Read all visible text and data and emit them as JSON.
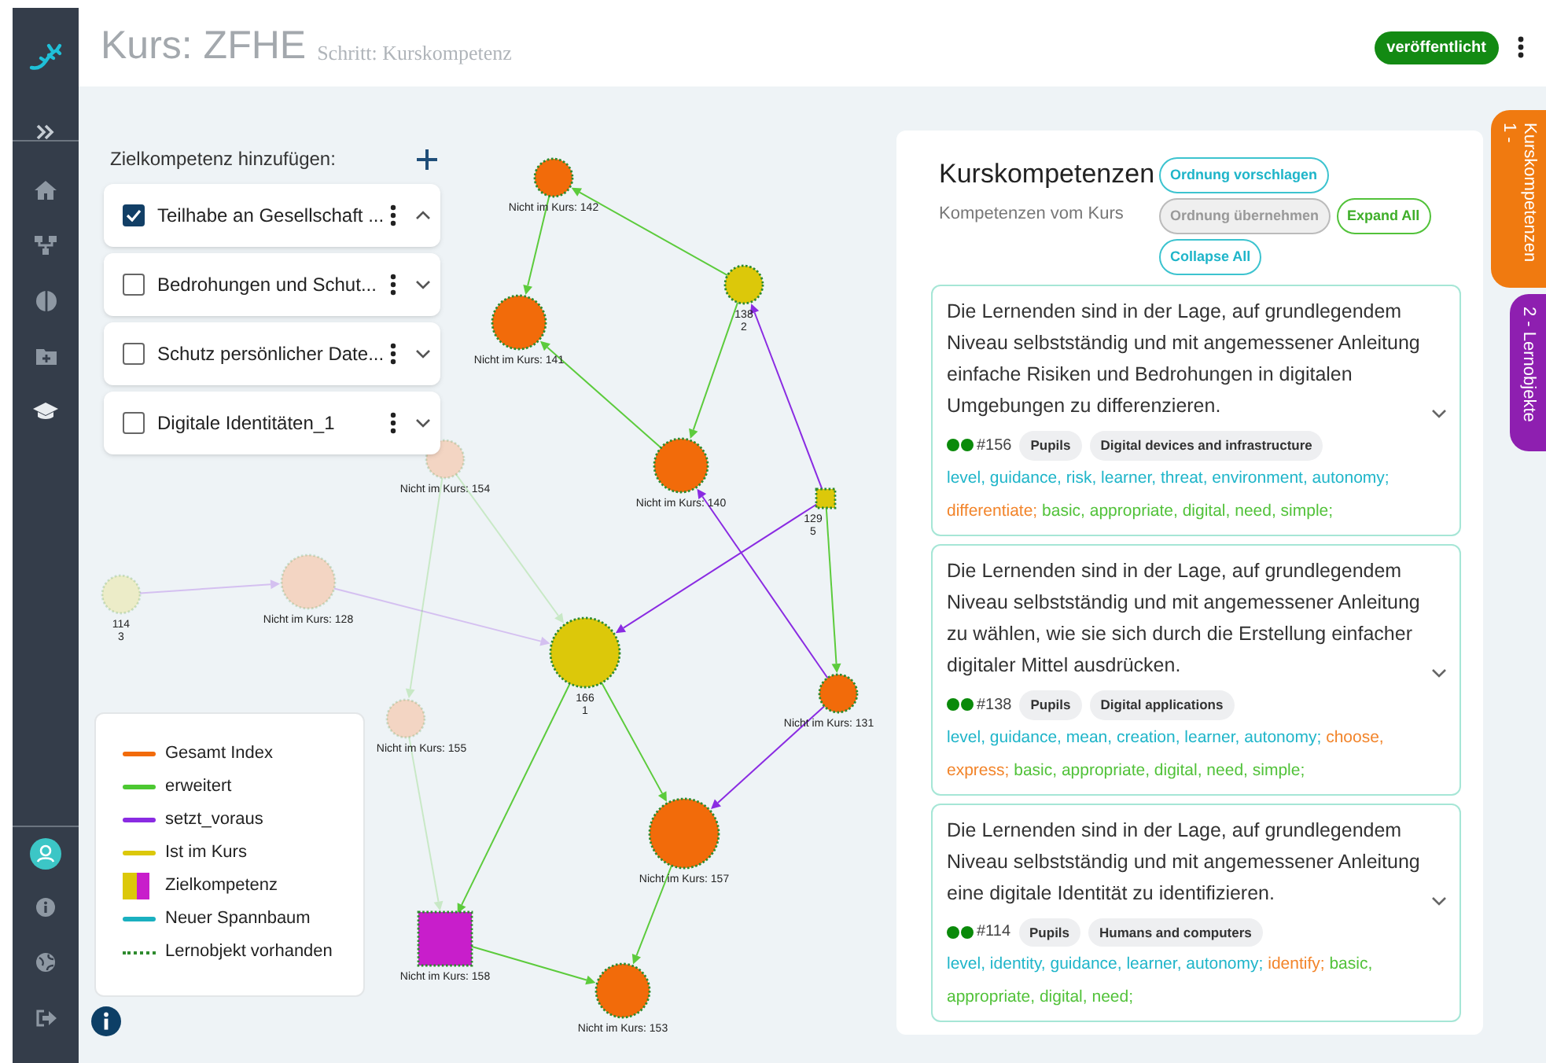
{
  "header": {
    "course_title": "Kurs: ZFHE",
    "step": "Schritt: Kurskompetenz",
    "status_badge": "veröffentlicht"
  },
  "goal_panel": {
    "title": "Zielkompetenz hinzufügen:",
    "items": [
      {
        "label": "Teilhabe an Gesellschaft ...",
        "checked": true,
        "expanded": true
      },
      {
        "label": "Bedrohungen und Schut...",
        "checked": false,
        "expanded": false
      },
      {
        "label": "Schutz persönlicher Date...",
        "checked": false,
        "expanded": false
      },
      {
        "label": "Digitale Identitäten_1",
        "checked": false,
        "expanded": false
      }
    ]
  },
  "graph": {
    "nodes": [
      {
        "label_lines": [
          "Nicht im Kurs: 142"
        ],
        "kind": "circle",
        "color": "#f26b0a",
        "faded": false
      },
      {
        "label_lines": [
          "Nicht im Kurs: 141"
        ],
        "kind": "circle",
        "color": "#f26b0a",
        "faded": false
      },
      {
        "label_lines": [
          "138",
          "2"
        ],
        "kind": "circle",
        "color": "#dcc80a",
        "faded": false
      },
      {
        "label_lines": [
          "Nicht im Kurs: 140"
        ],
        "kind": "circle",
        "color": "#f26b0a",
        "faded": false
      },
      {
        "label_lines": [
          "129",
          "5"
        ],
        "kind": "square",
        "color": "#dcc80a",
        "faded": false
      },
      {
        "label_lines": [
          "Nicht im Kurs: 154"
        ],
        "kind": "circle",
        "color": "#f3d5c3",
        "faded": true
      },
      {
        "label_lines": [
          "114",
          "3"
        ],
        "kind": "circle",
        "color": "#ececc8",
        "faded": true
      },
      {
        "label_lines": [
          "Nicht im Kurs: 128"
        ],
        "kind": "circle",
        "color": "#f3d5c3",
        "faded": true
      },
      {
        "label_lines": [
          "166",
          "1"
        ],
        "kind": "circle",
        "color": "#dcc80a",
        "faded": false
      },
      {
        "label_lines": [
          "Nicht im Kurs: 131"
        ],
        "kind": "circle",
        "color": "#f26b0a",
        "faded": false
      },
      {
        "label_lines": [
          "Nicht im Kurs: 155"
        ],
        "kind": "circle",
        "color": "#f3d5c3",
        "faded": true
      },
      {
        "label_lines": [
          "Nicht im Kurs: 157"
        ],
        "kind": "circle",
        "color": "#f26b0a",
        "faded": false
      },
      {
        "label_lines": [
          "Nicht im Kurs: 158"
        ],
        "kind": "square",
        "color": "#c81ecb",
        "faded": false
      },
      {
        "label_lines": [
          "Nicht im Kurs: 153"
        ],
        "kind": "circle",
        "color": "#f26b0a",
        "faded": false
      }
    ]
  },
  "legend": {
    "items": [
      {
        "label": "Gesamt Index",
        "kind": "line",
        "color": "#f26b0a"
      },
      {
        "label": "erweitert",
        "kind": "line",
        "color": "#4cc832"
      },
      {
        "label": "setzt_voraus",
        "kind": "line",
        "color": "#8a2be2"
      },
      {
        "label": "Ist im Kurs",
        "kind": "line",
        "color": "#dcc80a"
      },
      {
        "label": "Zielkompetenz",
        "kind": "split"
      },
      {
        "label": "Neuer Spannbaum",
        "kind": "line",
        "color": "#1ab0c0"
      },
      {
        "label": "Lernobjekt vorhanden",
        "kind": "dotted"
      }
    ]
  },
  "competency_panel": {
    "title": "Kurskompetenzen",
    "subtitle": "Kompetenzen vom Kurs",
    "buttons": [
      {
        "label": "Ordnung vorschlagen",
        "kind": "primary",
        "disabled": false
      },
      {
        "label": "Ordnung übernehmen",
        "disabled": true
      },
      {
        "label": "Expand All",
        "kind": "success",
        "disabled": false
      },
      {
        "label": "Collapse All",
        "kind": "primary",
        "disabled": false
      }
    ],
    "cards": [
      {
        "text": "Die Lernenden sind in der Lage, auf grundlegendem Niveau selbstständig und mit angemessener Anleitung einfache Risiken und Bedrohungen in digitalen Umgebungen zu differenzieren.",
        "id": "#156",
        "tags": [
          "Pupils",
          "Digital devices and infrastructure"
        ],
        "keywords": [
          {
            "text": "level, guidance, risk, learner, threat, environment, autonomy;",
            "color": "#1fb5c9"
          },
          {
            "text": "differentiate;",
            "color": "#f2842a"
          },
          {
            "text": "basic, appropriate, digital, need, simple;",
            "color": "#52c23a"
          }
        ]
      },
      {
        "text": "Die Lernenden sind in der Lage, auf grundlegendem Niveau selbstständig und mit angemessener Anleitung zu wählen, wie sie sich durch die Erstellung einfacher digitaler Mittel ausdrücken.",
        "id": "#138",
        "tags": [
          "Pupils",
          "Digital applications"
        ],
        "keywords": [
          {
            "text": "level, guidance, mean, creation, learner, autonomy;",
            "color": "#1fb5c9"
          },
          {
            "text": "choose, express;",
            "color": "#f2842a"
          },
          {
            "text": "basic, appropriate, digital, need, simple;",
            "color": "#52c23a"
          }
        ]
      },
      {
        "text": "Die Lernenden sind in der Lage, auf grundlegendem Niveau selbstständig und mit angemessener Anleitung eine digitale Identität zu identifizieren.",
        "id": "#114",
        "tags": [
          "Pupils",
          "Humans and computers"
        ],
        "keywords": [
          {
            "text": "level, identity, guidance, learner, autonomy;",
            "color": "#1fb5c9"
          },
          {
            "text": "identify;",
            "color": "#f2842a"
          },
          {
            "text": "basic, appropriate, digital, need;",
            "color": "#52c23a"
          }
        ]
      }
    ]
  },
  "side_tabs": [
    {
      "label": "1 - Kurskompetenzen",
      "selected": true
    },
    {
      "label": "2 - Lernobjekte",
      "selected": false
    }
  ]
}
